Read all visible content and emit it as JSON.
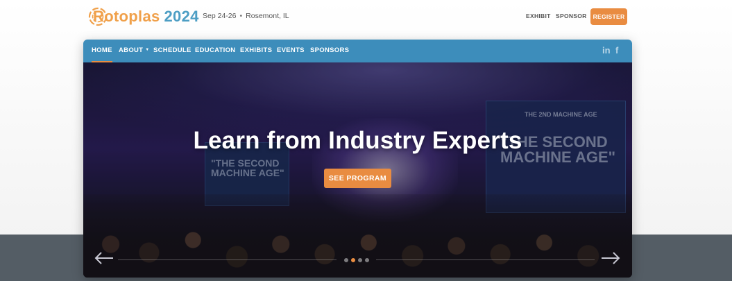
{
  "brand": {
    "name_part1": "Rotoplas",
    "name_part2": "2024"
  },
  "event": {
    "dates": "Sep 24-26",
    "separator": "•",
    "location": "Rosemont, IL"
  },
  "top_links": {
    "exhibit": "EXHIBIT",
    "sponsor": "SPONSOR",
    "register": "REGISTER"
  },
  "nav": {
    "items": [
      {
        "label": "HOME",
        "active": true
      },
      {
        "label": "ABOUT",
        "has_dropdown": true
      },
      {
        "label": "SCHEDULE"
      },
      {
        "label": "EDUCATION"
      },
      {
        "label": "EXHIBITS"
      },
      {
        "label": "EVENTS"
      },
      {
        "label": "SPONSORS"
      }
    ],
    "social": {
      "linkedin": "in",
      "facebook": "f"
    }
  },
  "hero": {
    "headline": "Learn from Industry Experts",
    "cta": "SEE PROGRAM",
    "slides_count": 4,
    "active_slide": 2,
    "photo_text": {
      "left_screen": "\"THE SECOND MACHINE AGE\"",
      "right_screen_top": "THE 2ND MACHINE AGE",
      "right_screen_main": "\"THE SECOND MACHINE AGE\""
    }
  },
  "colors": {
    "accent": "#e98c41",
    "nav_blue": "#3d8dbb",
    "brand_blue": "#4d9ec4",
    "brand_orange": "#f0a04a"
  },
  "icons": {
    "prev": "arrow-left-icon",
    "next": "arrow-right-icon",
    "linkedin": "linkedin-icon",
    "facebook": "facebook-icon"
  }
}
